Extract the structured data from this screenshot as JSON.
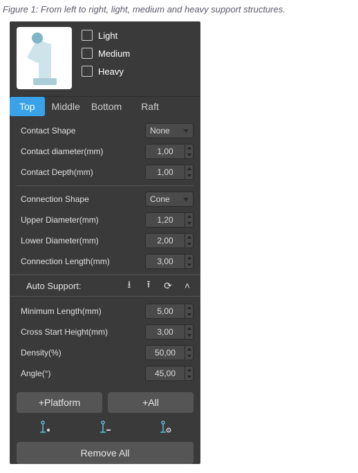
{
  "caption": "Figure 1: From left to right, light, medium  and heavy support structures.",
  "support_levels": {
    "light": "Light",
    "medium": "Medium",
    "heavy": "Heavy"
  },
  "tabs": {
    "top": "Top",
    "middle": "Middle",
    "bottom": "Bottom",
    "raft": "Raft"
  },
  "contact": {
    "shape_label": "Contact Shape",
    "shape_value": "None",
    "diameter_label": "Contact diameter(mm)",
    "diameter_value": "1,00",
    "depth_label": "Contact Depth(mm)",
    "depth_value": "1,00"
  },
  "connection": {
    "shape_label": "Connection Shape",
    "shape_value": "Cone",
    "upper_label": "Upper Diameter(mm)",
    "upper_value": "1,20",
    "lower_label": "Lower Diameter(mm)",
    "lower_value": "2,00",
    "length_label": "Connection Length(mm)",
    "length_value": "3,00"
  },
  "auto_support": {
    "title": "Auto Support:"
  },
  "params": {
    "min_len_label": "Minimum Length(mm)",
    "min_len_value": "5,00",
    "cross_label": "Cross Start Height(mm)",
    "cross_value": "3,00",
    "density_label": "Density(%)",
    "density_value": "50,00",
    "angle_label": "Angle(°)",
    "angle_value": "45,00"
  },
  "buttons": {
    "platform": "+Platform",
    "all": "+All",
    "remove": "Remove All"
  }
}
